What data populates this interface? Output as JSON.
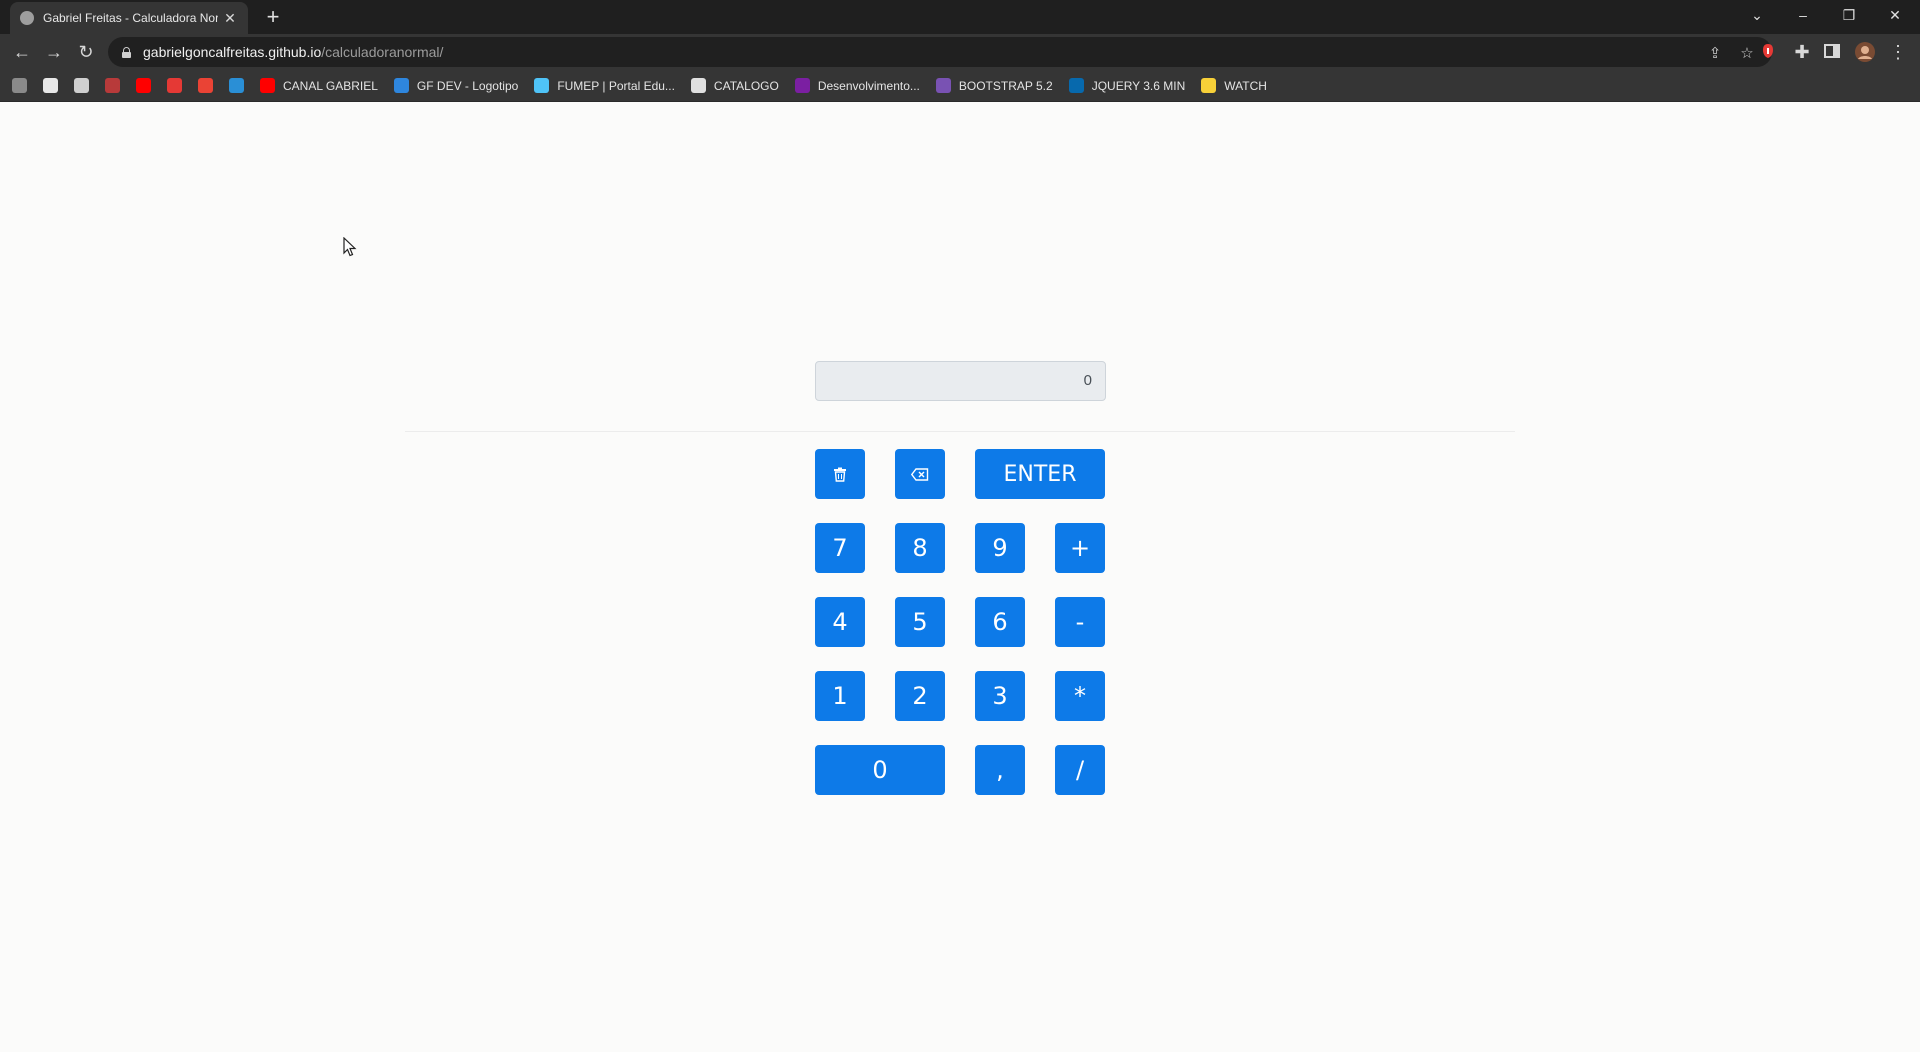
{
  "browser": {
    "tab_title": "Gabriel Freitas - Calculadora Normal",
    "new_tab": "+",
    "url_host": "gabrielgoncalfreitas.github.io",
    "url_path": "/calculadoranormal/",
    "icons": [
      "back-icon",
      "forward-icon",
      "reload-icon",
      "lock-icon",
      "share-icon",
      "star-icon",
      "extension-icon",
      "puzzle-icon",
      "sidepanel-icon",
      "profile-icon",
      "menu-icon"
    ],
    "bookmarks": [
      {
        "label": "",
        "color": "#8a8a8a"
      },
      {
        "label": "",
        "color": "#e8e8e8"
      },
      {
        "label": "",
        "color": "#cfcfcf"
      },
      {
        "label": "",
        "color": "#b83a3a"
      },
      {
        "label": "",
        "color": "#ff0000"
      },
      {
        "label": "",
        "color": "#e53935"
      },
      {
        "label": "",
        "color": "#ea4335"
      },
      {
        "label": "",
        "color": "#2a8fd6"
      },
      {
        "label": "CANAL GABRIEL",
        "color": "#ff0000"
      },
      {
        "label": "GF DEV - Logotipo",
        "color": "#2e86de"
      },
      {
        "label": "FUMEP | Portal Edu...",
        "color": "#4fc3f7"
      },
      {
        "label": "CATALOGO",
        "color": "#e0e0e0"
      },
      {
        "label": "Desenvolvimento...",
        "color": "#7b1fa2"
      },
      {
        "label": "BOOTSTRAP 5.2",
        "color": "#7952b3"
      },
      {
        "label": "JQUERY 3.6 MIN",
        "color": "#0769ad"
      },
      {
        "label": "WATCH",
        "color": "#f7d038"
      }
    ]
  },
  "calculator": {
    "display_value": "0",
    "keys": {
      "clear": "",
      "backspace": "",
      "enter": "ENTER",
      "seven": "7",
      "eight": "8",
      "nine": "9",
      "plus": "+",
      "four": "4",
      "five": "5",
      "six": "6",
      "minus": "-",
      "one": "1",
      "two": "2",
      "three": "3",
      "multiply": "*",
      "zero": "0",
      "comma": ",",
      "divide": "/"
    },
    "accent_color": "#0d7ae8"
  }
}
